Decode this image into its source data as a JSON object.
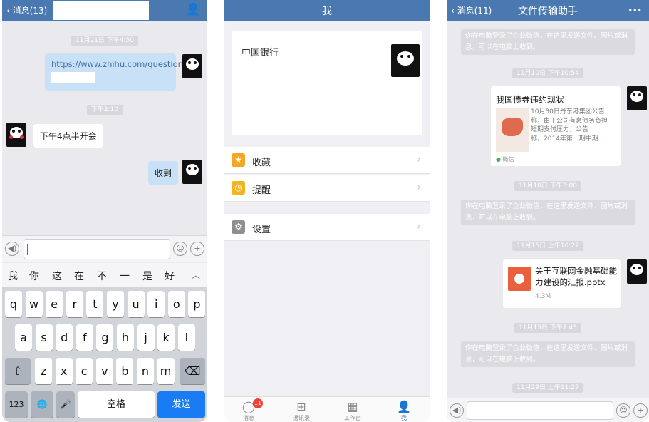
{
  "phone1": {
    "nav": {
      "back_label": "消息(13)",
      "contact_icon": "person-icon"
    },
    "time1": "11月21日 下午4:50",
    "msg_link": "https://www.zhihu.com/question/",
    "time2": "下午2:10",
    "msg_other": "下午4点半开会",
    "msg_me": "收到",
    "candidates": [
      "我",
      "你",
      "这",
      "在",
      "不",
      "一",
      "是",
      "好"
    ],
    "expand_icon": "chevron-up-icon",
    "row1": [
      "q",
      "w",
      "e",
      "r",
      "t",
      "y",
      "u",
      "i",
      "o",
      "p"
    ],
    "row2": [
      "a",
      "s",
      "d",
      "f",
      "g",
      "h",
      "j",
      "k",
      "l"
    ],
    "row3": [
      "z",
      "x",
      "c",
      "v",
      "b",
      "n",
      "m"
    ],
    "key_123": "123",
    "key_space": "空格",
    "key_send": "发送",
    "shift_icon": "⇧",
    "delete_icon": "⌫",
    "globe_icon": "🌐",
    "mic_icon": "🎤"
  },
  "phone2": {
    "title": "我",
    "company": "中国银行",
    "menu": [
      {
        "label": "收藏",
        "icon": "★",
        "color": "#f5a623"
      },
      {
        "label": "提醒",
        "icon": "◷",
        "color": "#f5b323"
      },
      {
        "label": "设置",
        "icon": "⚙",
        "color": "#8e8e93"
      }
    ],
    "tabs": [
      {
        "label": "消息",
        "icon": "◯",
        "badge": "11"
      },
      {
        "label": "通讯录",
        "icon": "⊞"
      },
      {
        "label": "工作台",
        "icon": "▦"
      },
      {
        "label": "我",
        "icon": "👤"
      }
    ],
    "accent": "#4a79b1"
  },
  "phone3": {
    "nav": {
      "back_label": "消息(11)",
      "title": "文件传输助手",
      "more_icon": "•••"
    },
    "sys_msg": "你在电脑登录了企业微信，在这里发送文件、图片或消息，可以在电脑上收到。",
    "time1": "11月10日 下午10:54",
    "article": {
      "title": "我国债券违约现状",
      "body": "10月30日丹东港集团公告称，由于公司有息债务负担\n短期支付压力，公告\n称，2014年第一期中期...",
      "source": "微信"
    },
    "time2": "11月10日 下午3:00",
    "time3": "11月15日 上午10:22",
    "file": {
      "name": "关于互联网金融基础能力建设的汇报.pptx",
      "size": "4.3M"
    },
    "time4": "11月15日 下午7:43",
    "time5": "11月29日 上午11:27"
  }
}
